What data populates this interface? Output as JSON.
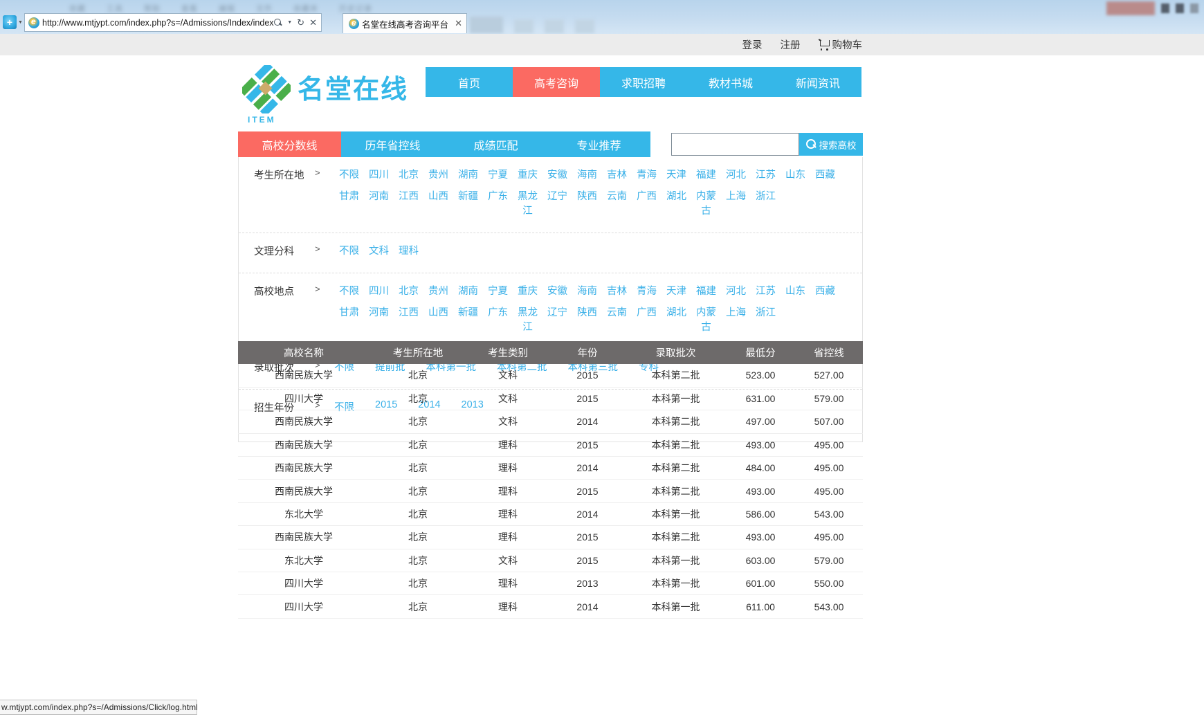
{
  "browser": {
    "url": "http://www.mtjypt.com/index.php?s=/Admissions/Index/index.html",
    "tab_title": "名堂在线高考咨询平台",
    "tab_close": "✕",
    "refresh_icon": "↻",
    "stop_icon": "✕",
    "search_icon": "search-icon",
    "compat_icon": "+",
    "status_text": "w.mtjypt.com/index.php?s=/Admissions/Click/log.html",
    "blur_tabs": [
      "收藏",
      "工具",
      "帮助",
      "查看",
      "编辑",
      "文件",
      "收藏夹",
      "历史记录"
    ]
  },
  "topbar": {
    "login": "登录",
    "register": "注册",
    "cart": "购物车"
  },
  "header": {
    "logo_text": "名堂在线",
    "logo_sub": "ITEM",
    "nav": [
      {
        "label": "首页",
        "active": false
      },
      {
        "label": "高考咨询",
        "active": true
      },
      {
        "label": "求职招聘",
        "active": false
      },
      {
        "label": "教材书城",
        "active": false
      },
      {
        "label": "新闻资讯",
        "active": false
      }
    ]
  },
  "filter": {
    "tabs": [
      {
        "label": "高校分数线",
        "active": true
      },
      {
        "label": "历年省控线",
        "active": false
      },
      {
        "label": "成绩匹配",
        "active": false
      },
      {
        "label": "专业推荐",
        "active": false
      }
    ],
    "search_placeholder": "",
    "search_value": "",
    "search_button": "搜索高校",
    "arrow": ">",
    "rows": [
      {
        "label": "考生所在地",
        "options": [
          "不限",
          "四川",
          "北京",
          "贵州",
          "湖南",
          "宁夏",
          "重庆",
          "安徽",
          "海南",
          "吉林",
          "青海",
          "天津",
          "福建",
          "河北",
          "江苏",
          "山东",
          "西藏",
          "甘肃",
          "河南",
          "江西",
          "山西",
          "新疆",
          "广东",
          "黑龙江",
          "辽宁",
          "陕西",
          "云南",
          "广西",
          "湖北",
          "内蒙古",
          "上海",
          "浙江"
        ]
      },
      {
        "label": "文理分科",
        "options": [
          "不限",
          "文科",
          "理科"
        ]
      },
      {
        "label": "高校地点",
        "options": [
          "不限",
          "四川",
          "北京",
          "贵州",
          "湖南",
          "宁夏",
          "重庆",
          "安徽",
          "海南",
          "吉林",
          "青海",
          "天津",
          "福建",
          "河北",
          "江苏",
          "山东",
          "西藏",
          "甘肃",
          "河南",
          "江西",
          "山西",
          "新疆",
          "广东",
          "黑龙江",
          "辽宁",
          "陕西",
          "云南",
          "广西",
          "湖北",
          "内蒙古",
          "上海",
          "浙江"
        ]
      },
      {
        "label": "录取批次",
        "options": [
          "不限",
          "提前批",
          "本科第一批",
          "本科第二批",
          "本科第三批",
          "专科"
        ]
      },
      {
        "label": "招生年份",
        "options": [
          "不限",
          "2015",
          "2014",
          "2013"
        ]
      }
    ]
  },
  "results": {
    "columns": [
      "高校名称",
      "考生所在地",
      "考生类别",
      "年份",
      "录取批次",
      "最低分",
      "省控线"
    ],
    "rows": [
      [
        "西南民族大学",
        "北京",
        "文科",
        "2015",
        "本科第二批",
        "523.00",
        "527.00"
      ],
      [
        "四川大学",
        "北京",
        "文科",
        "2015",
        "本科第一批",
        "631.00",
        "579.00"
      ],
      [
        "西南民族大学",
        "北京",
        "文科",
        "2014",
        "本科第二批",
        "497.00",
        "507.00"
      ],
      [
        "西南民族大学",
        "北京",
        "理科",
        "2015",
        "本科第二批",
        "493.00",
        "495.00"
      ],
      [
        "西南民族大学",
        "北京",
        "理科",
        "2014",
        "本科第二批",
        "484.00",
        "495.00"
      ],
      [
        "西南民族大学",
        "北京",
        "理科",
        "2015",
        "本科第二批",
        "493.00",
        "495.00"
      ],
      [
        "东北大学",
        "北京",
        "理科",
        "2014",
        "本科第一批",
        "586.00",
        "543.00"
      ],
      [
        "西南民族大学",
        "北京",
        "理科",
        "2015",
        "本科第二批",
        "493.00",
        "495.00"
      ],
      [
        "东北大学",
        "北京",
        "文科",
        "2015",
        "本科第一批",
        "603.00",
        "579.00"
      ],
      [
        "四川大学",
        "北京",
        "理科",
        "2013",
        "本科第一批",
        "601.00",
        "550.00"
      ],
      [
        "四川大学",
        "北京",
        "理科",
        "2014",
        "本科第一批",
        "611.00",
        "543.00"
      ]
    ]
  },
  "colors": {
    "brand_blue": "#35b7e8",
    "accent_red": "#fb6a62",
    "table_header": "#6d6a6a",
    "link_blue": "#3ab0e8"
  }
}
